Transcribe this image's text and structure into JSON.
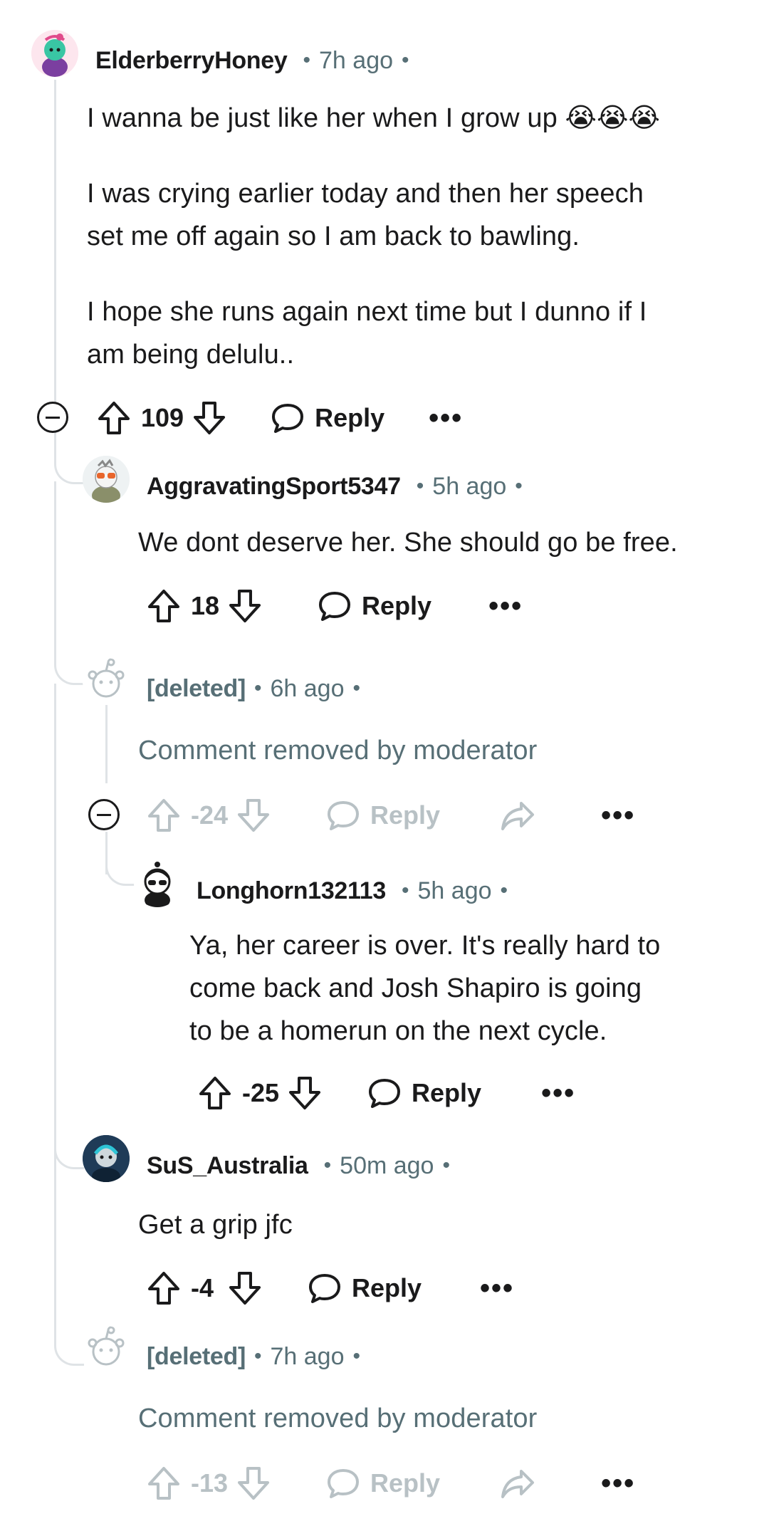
{
  "comments": [
    {
      "username": "ElderberryHoney",
      "time": "7h ago",
      "paragraphs": [
        "I wanna be just like her when I grow up",
        "I was crying earlier today and then her speech\nset me off again so I am back to bawling.",
        "I hope she runs again next time but I dunno if I\nam being delulu.."
      ],
      "emoji": "😭😭😭",
      "score": "109",
      "reply_label": "Reply"
    },
    {
      "username": "AggravatingSport5347",
      "time": "5h ago",
      "text": "We dont deserve her. She should go be free.",
      "score": "18",
      "reply_label": "Reply"
    },
    {
      "username": "[deleted]",
      "time": "6h ago",
      "text": "Comment removed by moderator",
      "score": "-24",
      "reply_label": "Reply"
    },
    {
      "username": "Longhorn132113",
      "time": "5h ago",
      "text": "Ya, her career is over. It's really hard to\ncome back and Josh Shapiro is going\nto be a homerun on the next cycle.",
      "score": "-25",
      "reply_label": "Reply"
    },
    {
      "username": "SuS_Australia",
      "time": "50m ago",
      "text": "Get a grip jfc",
      "score": "-4",
      "reply_label": "Reply"
    },
    {
      "username": "[deleted]",
      "time": "7h ago",
      "text": "Comment removed by moderator",
      "score": "-13",
      "reply_label": "Reply"
    }
  ],
  "separator": "•",
  "more_label": "•••",
  "colors": {
    "text": "#1a1a1b",
    "meta": "#576f76",
    "thread_line": "#dfe3e6",
    "dimmed": "#b8c1c5"
  }
}
